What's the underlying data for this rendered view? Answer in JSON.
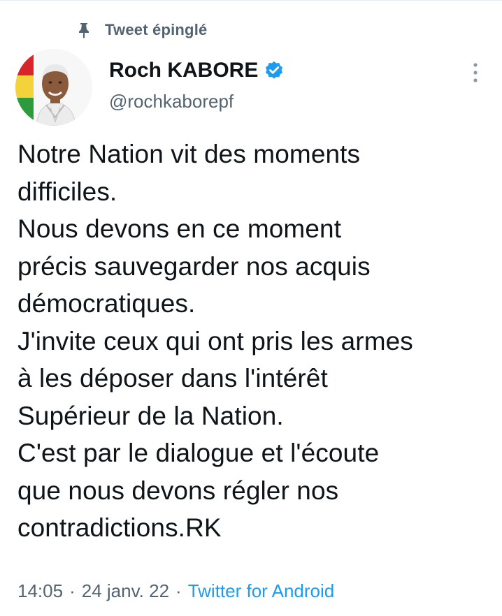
{
  "pinned": {
    "icon": "pin-icon",
    "label": "Tweet épinglé"
  },
  "author": {
    "name": "Roch KABORE",
    "handle": "@rochkaborepf",
    "verified_icon": "verified-badge-icon",
    "verified_color": "#1d9bf0",
    "avatar_icon": "avatar-photo"
  },
  "more_icon": "more-vertical-icon",
  "tweet": {
    "text": "Notre Nation vit des moments\ndifficiles.\nNous devons en ce moment\nprécis sauvegarder nos acquis\ndémocratiques.\nJ'invite ceux qui ont pris les armes\nà les déposer dans l'intérêt\nSupérieur de la Nation.\nC'est par le dialogue et l'écoute\nque nous devons régler nos\ncontradictions.RK"
  },
  "meta": {
    "time": "14:05",
    "separator": "·",
    "date": "24 janv. 22",
    "source": "Twitter for Android"
  },
  "colors": {
    "text_primary": "#0f1419",
    "text_secondary": "#536471",
    "accent": "#1d9bf0"
  }
}
